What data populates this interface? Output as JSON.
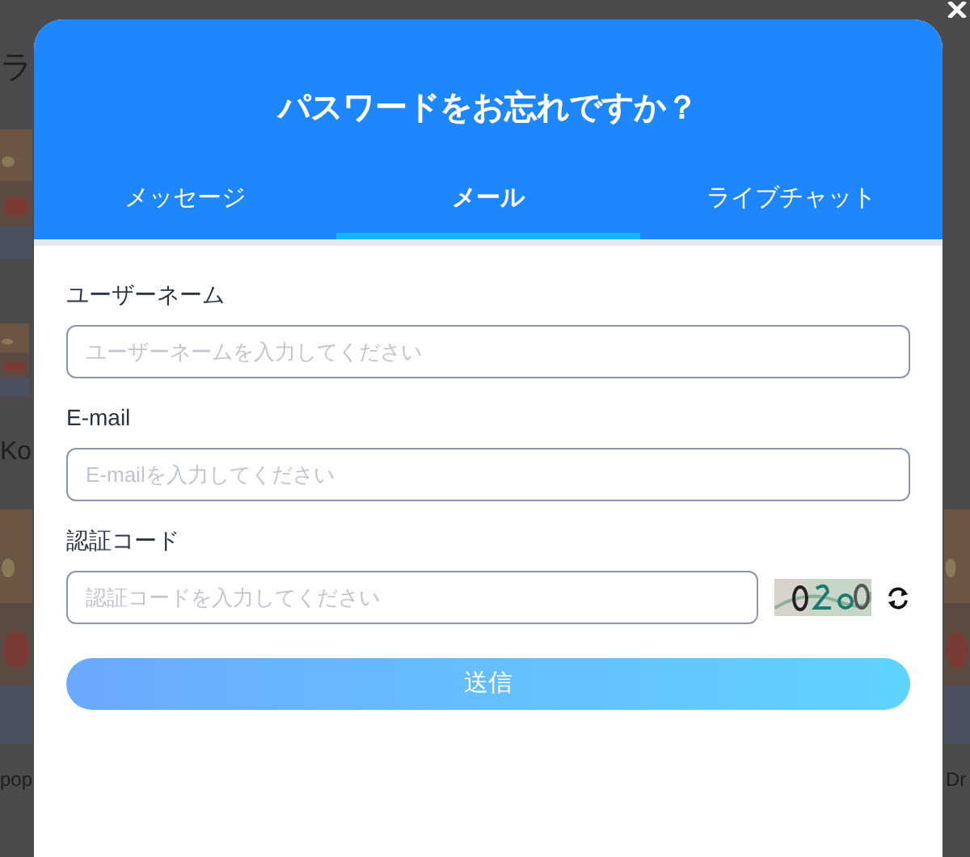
{
  "background_fragments": [
    "ラ",
    "Ko",
    "pop",
    "Dr"
  ],
  "dialog": {
    "title": "パスワードをお忘れですか？",
    "tabs": [
      {
        "label": "メッセージ",
        "selected": false
      },
      {
        "label": "メール",
        "selected": true
      },
      {
        "label": "ライブチャット",
        "selected": false
      }
    ],
    "fields": [
      {
        "label": "ユーザーネーム",
        "placeholder": "ユーザーネームを入力してください",
        "kind": "text"
      },
      {
        "label": "E-mail",
        "placeholder": "E-mailを入力してください",
        "kind": "text"
      },
      {
        "label": "認証コード",
        "placeholder": "認証コードを入力してください",
        "kind": "captcha"
      }
    ],
    "submit": "送信"
  }
}
